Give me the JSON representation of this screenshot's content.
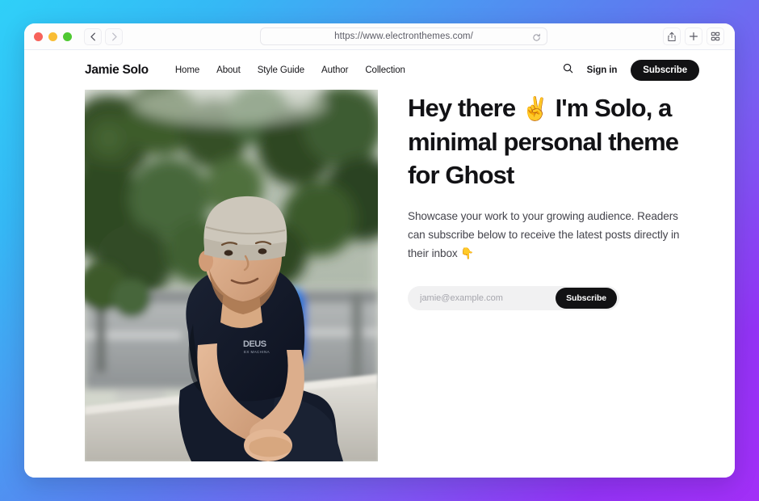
{
  "browser": {
    "url": "https://www.electronthemes.com/",
    "traffic_lights": [
      "close",
      "minimize",
      "maximize"
    ],
    "back_icon": "chevron-left-icon",
    "forward_icon": "chevron-right-icon",
    "reload_icon": "reload-icon",
    "share_icon": "share-icon",
    "new_tab_icon": "plus-icon",
    "tab_overview_icon": "grid-icon"
  },
  "site": {
    "brand": "Jamie Solo",
    "menu": [
      {
        "label": "Home"
      },
      {
        "label": "About"
      },
      {
        "label": "Style Guide"
      },
      {
        "label": "Author"
      },
      {
        "label": "Collection"
      }
    ],
    "search_icon": "search-icon",
    "signin_label": "Sign in",
    "subscribe_label": "Subscribe",
    "hero": {
      "headline_part1": "Hey there",
      "headline_emoji": "✌️",
      "headline_part2": "I'm Solo, a minimal personal theme for Ghost",
      "lede": "Showcase your work to your growing audience. Readers can subscribe below to receive the latest posts directly in their inbox 👇",
      "email_placeholder": "jamie@example.com",
      "email_value": "",
      "subscribe_label": "Subscribe",
      "photo_alt": "Portrait of a bearded man in a grey beanie and navy t-shirt sitting on a concrete ledge with blurred green trees and a street behind him"
    }
  },
  "colors": {
    "accent_dark": "#121214",
    "page_bg": "#ffffff",
    "gradient_start": "#2fd0f8",
    "gradient_mid": "#5b7ef0",
    "gradient_end": "#a22ff7",
    "input_bg": "#f1f1f2"
  }
}
